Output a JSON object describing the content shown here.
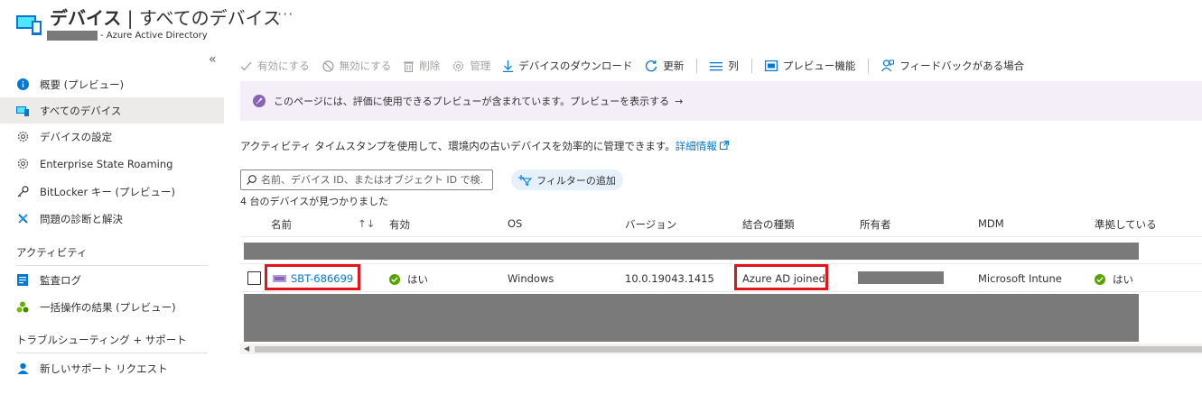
{
  "header": {
    "title_bold": "デバイス",
    "title_rest": " | すべてのデバイス",
    "more": "···",
    "subtitle": "- Azure Active Directory"
  },
  "sidebar": {
    "collapse": "«",
    "items": [
      {
        "label": "概要 (プレビュー)",
        "icon": "info-icon"
      },
      {
        "label": "すべてのデバイス",
        "icon": "devices-icon"
      },
      {
        "label": "デバイスの設定",
        "icon": "gear-icon"
      },
      {
        "label": "Enterprise State Roaming",
        "icon": "gear-icon"
      },
      {
        "label": "BitLocker キー (プレビュー)",
        "icon": "key-icon"
      },
      {
        "label": "問題の診断と解決",
        "icon": "wrench-icon"
      }
    ],
    "section_activity": "アクティビティ",
    "activity_items": [
      {
        "label": "監査ログ",
        "icon": "log-icon"
      },
      {
        "label": "一括操作の結果 (プレビュー)",
        "icon": "bulk-icon"
      }
    ],
    "section_support": "トラブルシューティング + サポート",
    "support_items": [
      {
        "label": "新しいサポート リクエスト",
        "icon": "support-icon"
      }
    ]
  },
  "toolbar": {
    "enable": "有効にする",
    "disable": "無効にする",
    "delete": "削除",
    "manage": "管理",
    "download": "デバイスのダウンロード",
    "refresh": "更新",
    "columns": "列",
    "preview": "プレビュー機能",
    "feedback": "フィードバックがある場合"
  },
  "banner": {
    "text": "このページには、評価に使用できるプレビューが含まれています。プレビューを表示する",
    "arrow": "→"
  },
  "info": {
    "text": "アクティビティ タイムスタンプを使用して、環境内の古いデバイスを効率的に管理できます。",
    "link": "詳細情報"
  },
  "search": {
    "placeholder": "名前、デバイス ID、またはオブジェクト ID で検..."
  },
  "filter": {
    "label": "フィルターの追加"
  },
  "count": "4 台のデバイスが見つかりました",
  "table": {
    "headers": {
      "name": "名前",
      "sort": "↑↓",
      "enabled": "有効",
      "os": "OS",
      "version": "バージョン",
      "join_type": "結合の種類",
      "owner": "所有者",
      "mdm": "MDM",
      "compliant": "準拠している"
    },
    "row": {
      "name": "SBT-686699",
      "enabled": "はい",
      "os": "Windows",
      "version": "10.0.19043.1415",
      "join_type": "Azure AD joined",
      "mdm": "Microsoft Intune",
      "compliant": "はい"
    }
  },
  "colors": {
    "accent": "#0078d4",
    "highlight": "#e3151a",
    "ok": "#57a300",
    "preview": "#8764b8",
    "redacted": "#7a7a7a"
  }
}
